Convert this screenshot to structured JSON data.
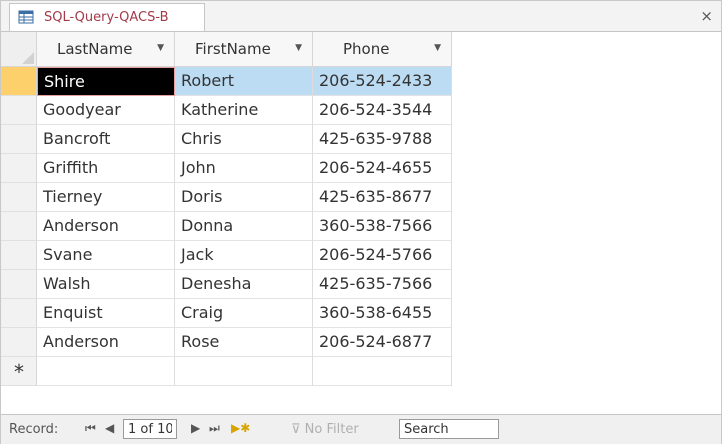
{
  "tab": {
    "title": "SQL-Query-QACS-B",
    "close": "×"
  },
  "columns": [
    "LastName",
    "FirstName",
    "Phone"
  ],
  "rows": [
    [
      "Shire",
      "Robert",
      "206-524-2433"
    ],
    [
      "Goodyear",
      "Katherine",
      "206-524-3544"
    ],
    [
      "Bancroft",
      "Chris",
      "425-635-9788"
    ],
    [
      "Griffith",
      "John",
      "206-524-4655"
    ],
    [
      "Tierney",
      "Doris",
      "425-635-8677"
    ],
    [
      "Anderson",
      "Donna",
      "360-538-7566"
    ],
    [
      "Svane",
      "Jack",
      "206-524-5766"
    ],
    [
      "Walsh",
      "Denesha",
      "425-635-7566"
    ],
    [
      "Enquist",
      "Craig",
      "360-538-6455"
    ],
    [
      "Anderson",
      "Rose",
      "206-524-6877"
    ]
  ],
  "new_record_marker": "*",
  "status": {
    "record_label": "Record:",
    "position": "1 of 10",
    "no_filter": "No Filter",
    "search": "Search"
  },
  "icons": {
    "tab": "query-datasheet-icon",
    "first": "first-record-icon",
    "prev": "previous-record-icon",
    "next": "next-record-icon",
    "last": "last-record-icon",
    "new": "new-record-icon",
    "filter": "no-filter-icon"
  },
  "colors": {
    "current_row_selector": "#fdd06b",
    "selected_row": "#bcdcf4",
    "active_cell": "#000000",
    "tab_title": "#a23a4a"
  }
}
